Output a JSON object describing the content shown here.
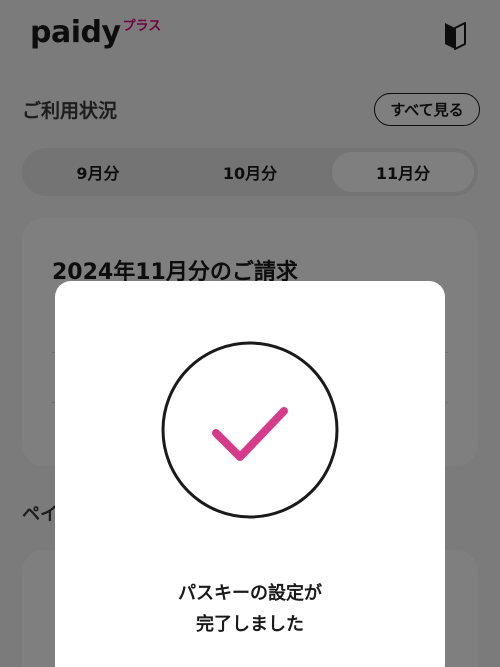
{
  "header": {
    "logo_main": "paidy",
    "logo_plus": "プラス",
    "beginner_icon": "beginner-mark-icon"
  },
  "usage": {
    "section_title": "ご利用状況",
    "see_all_label": "すべて見る",
    "tabs": [
      {
        "label": "9月分",
        "selected": false
      },
      {
        "label": "10月分",
        "selected": false
      },
      {
        "label": "11月分",
        "selected": true
      }
    ],
    "bill_title": "2024年11月分のご請求"
  },
  "payment": {
    "section_title_partial": "ペイ"
  },
  "modal": {
    "icon": "checkmark-circle-icon",
    "message_line1": "パスキーの設定が",
    "message_line2": "完了しました"
  },
  "colors": {
    "brand_accent": "#e3007f",
    "check_color": "#d63a8a",
    "overlay": "rgba(0,0,0,0.5)"
  }
}
